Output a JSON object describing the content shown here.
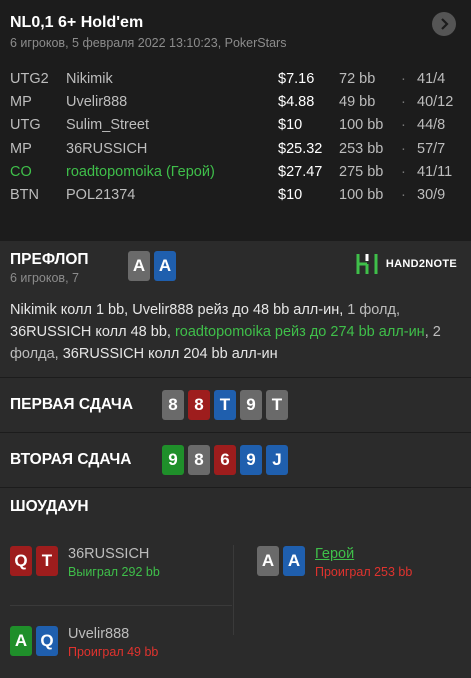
{
  "header": {
    "title": "NL0,1 6+ Hold'em",
    "subtitle": "6 игроков, 5 февраля 2022 13:10:23, PokerStars"
  },
  "players": [
    {
      "pos": "UTG2",
      "name": "Nikimik",
      "stack": "$7.16",
      "bb": "72 bb",
      "stats": "41/4",
      "hero": false
    },
    {
      "pos": "MP",
      "name": "Uvelir888",
      "stack": "$4.88",
      "bb": "49 bb",
      "stats": "40/12",
      "hero": false
    },
    {
      "pos": "UTG",
      "name": "Sulim_Street",
      "stack": "$10",
      "bb": "100 bb",
      "stats": "44/8",
      "hero": false
    },
    {
      "pos": "MP",
      "name": "36RUSSICH",
      "stack": "$25.32",
      "bb": "253 bb",
      "stats": "57/7",
      "hero": false
    },
    {
      "pos": "CO",
      "name": "roadtopomoika (Герой)",
      "stack": "$27.47",
      "bb": "275 bb",
      "stats": "41/11",
      "hero": true
    },
    {
      "pos": "BTN",
      "name": "POL21374",
      "stack": "$10",
      "bb": "100 bb",
      "stats": "30/9",
      "hero": false
    }
  ],
  "separator": "·",
  "preflop": {
    "title": "ПРЕФЛОП",
    "subtitle": "6 игроков, 7",
    "hero_cards": [
      {
        "rank": "A",
        "color": "grey"
      },
      {
        "rank": "A",
        "color": "blue"
      }
    ],
    "logo_text": "HAND2NOTE",
    "action": {
      "p1_name": "Nikimik",
      "p1_act": " колл 1 bb, ",
      "p2_name": "Uvelir888",
      "p2_act": " рейз до 48 bb алл-ин, ",
      "fold1": "1 фолд, ",
      "p3_name": "36RUSSICH",
      "p3_act": " колл 48 bb, ",
      "hero_name": "roadtopomoika",
      "hero_act": " рейз до 274 bb алл-ин",
      "fold2": ", 2 фолда, ",
      "p4_name": "36RUSSICH",
      "p4_act": " колл 204 bb алл-ин"
    }
  },
  "first_run": {
    "title": "ПЕРВАЯ СДАЧА",
    "cards": [
      {
        "rank": "8",
        "color": "grey"
      },
      {
        "rank": "8",
        "color": "red"
      },
      {
        "rank": "T",
        "color": "blue"
      },
      {
        "rank": "9",
        "color": "grey"
      },
      {
        "rank": "T",
        "color": "grey"
      }
    ]
  },
  "second_run": {
    "title": "ВТОРАЯ СДАЧА",
    "cards": [
      {
        "rank": "9",
        "color": "green"
      },
      {
        "rank": "8",
        "color": "grey"
      },
      {
        "rank": "6",
        "color": "red"
      },
      {
        "rank": "9",
        "color": "blue"
      },
      {
        "rank": "J",
        "color": "blue"
      }
    ]
  },
  "showdown": {
    "title": "ШОУДАУН",
    "entries": [
      {
        "name": "36RUSSICH",
        "result": "Выиграл 292 bb",
        "win": true,
        "cards": [
          {
            "rank": "Q",
            "color": "red"
          },
          {
            "rank": "T",
            "color": "red"
          }
        ]
      },
      {
        "name": "Герой",
        "result": "Проиграл 253 bb",
        "win": false,
        "hero": true,
        "cards": [
          {
            "rank": "A",
            "color": "grey"
          },
          {
            "rank": "A",
            "color": "blue"
          }
        ]
      },
      {
        "name": "Uvelir888",
        "result": "Проиграл 49 bb",
        "win": false,
        "cards": [
          {
            "rank": "A",
            "color": "green"
          },
          {
            "rank": "Q",
            "color": "blue"
          }
        ]
      }
    ]
  },
  "colors": {
    "grey": "#6a6a6a",
    "blue": "#1f5fae",
    "red": "#9e1d1d",
    "green": "#1f8f2a",
    "hero": "#3fbf4a",
    "lose": "#e0332e"
  },
  "icons": {
    "next": "chevron-right-icon",
    "logo": "hand2note-logo-icon"
  }
}
